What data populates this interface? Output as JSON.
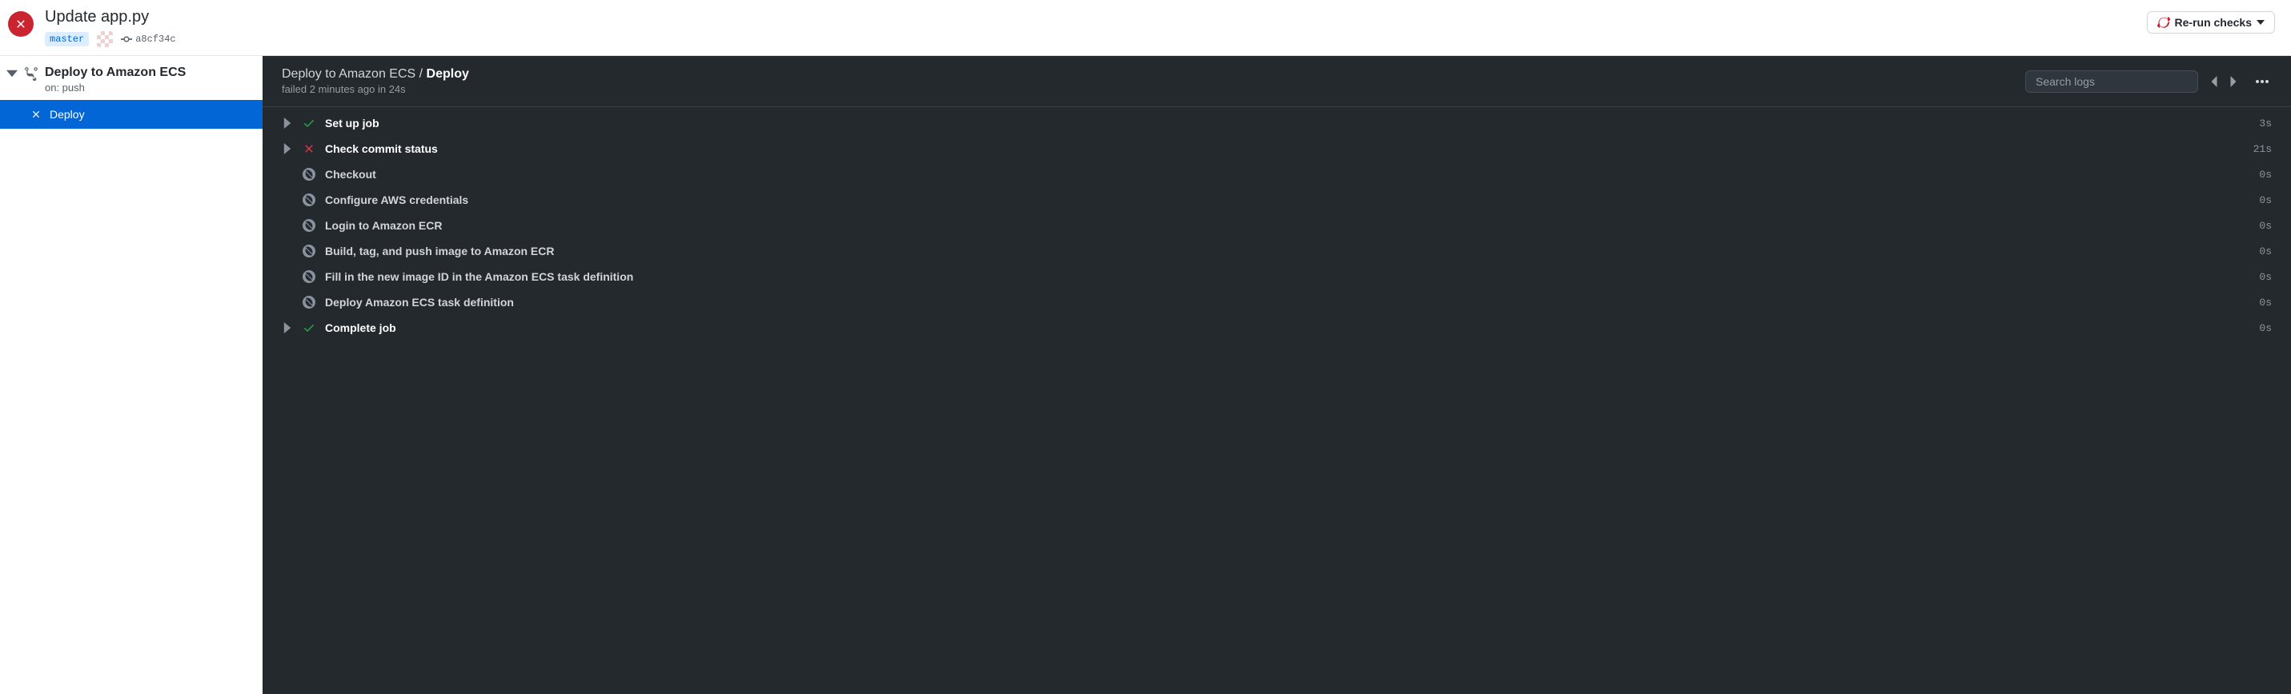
{
  "header": {
    "title": "Update app.py",
    "branch": "master",
    "commit_sha": "a8cf34c",
    "rerun_label": "Re-run checks"
  },
  "sidebar": {
    "workflow_name": "Deploy to Amazon ECS",
    "workflow_trigger": "on: push",
    "job_name": "Deploy"
  },
  "content": {
    "breadcrumb_parent": "Deploy to Amazon ECS",
    "breadcrumb_separator": " / ",
    "breadcrumb_current": "Deploy",
    "status_line": "failed 2 minutes ago in 24s",
    "search_placeholder": "Search logs"
  },
  "steps": [
    {
      "name": "Set up job",
      "status": "success",
      "duration": "3s",
      "expandable": true
    },
    {
      "name": "Check commit status",
      "status": "failed",
      "duration": "21s",
      "expandable": true
    },
    {
      "name": "Checkout",
      "status": "skipped",
      "duration": "0s",
      "expandable": false
    },
    {
      "name": "Configure AWS credentials",
      "status": "skipped",
      "duration": "0s",
      "expandable": false
    },
    {
      "name": "Login to Amazon ECR",
      "status": "skipped",
      "duration": "0s",
      "expandable": false
    },
    {
      "name": "Build, tag, and push image to Amazon ECR",
      "status": "skipped",
      "duration": "0s",
      "expandable": false
    },
    {
      "name": "Fill in the new image ID in the Amazon ECS task definition",
      "status": "skipped",
      "duration": "0s",
      "expandable": false
    },
    {
      "name": "Deploy Amazon ECS task definition",
      "status": "skipped",
      "duration": "0s",
      "expandable": false
    },
    {
      "name": "Complete job",
      "status": "success",
      "duration": "0s",
      "expandable": true
    }
  ]
}
